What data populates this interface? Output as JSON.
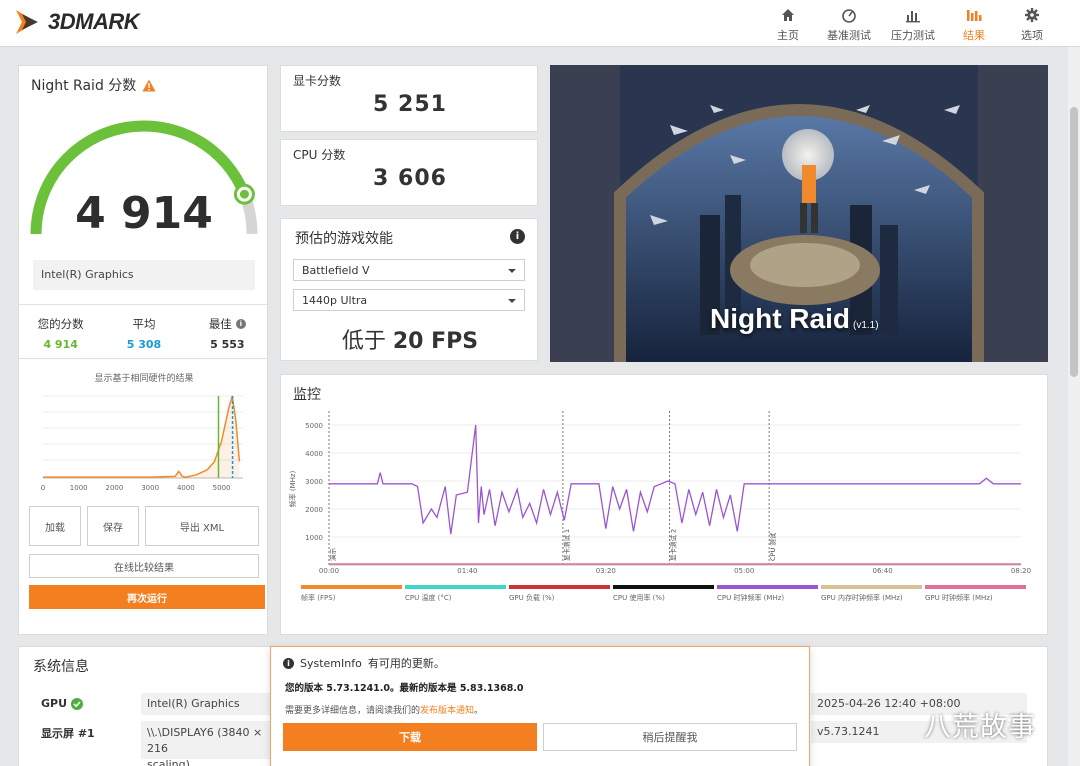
{
  "header": {
    "logo_text": "3DMARK",
    "nav": [
      {
        "label": "主页",
        "icon": "home-icon"
      },
      {
        "label": "基准测试",
        "icon": "gauge-icon"
      },
      {
        "label": "压力测试",
        "icon": "stress-icon"
      },
      {
        "label": "结果",
        "icon": "bar-chart-icon",
        "active": true
      },
      {
        "label": "选项",
        "icon": "gear-icon"
      }
    ],
    "accent_color": "#f47f20"
  },
  "score_card": {
    "title": "Night Raid 分数",
    "score": "4 914",
    "gauge_fraction": 0.88,
    "gpu": "Intel(R) Graphics",
    "stats": [
      {
        "label": "您的分数",
        "value": "4 914",
        "color": "#66b82f"
      },
      {
        "label": "平均",
        "value": "5 308",
        "color": "#1a9ad6"
      },
      {
        "label": "最佳",
        "value": "5 553",
        "color": "#333333"
      }
    ],
    "histogram_caption": "显示基于相同硬件的结果",
    "buttons": {
      "load": "加载",
      "save": "保存",
      "export": "导出 XML",
      "compare": "在线比较结果",
      "rerun": "再次运行"
    }
  },
  "gpu_score": {
    "label": "显卡分数",
    "value": "5 251"
  },
  "cpu_score": {
    "label": "CPU 分数",
    "value": "3 606"
  },
  "game_perf": {
    "title": "预估的游戏效能",
    "game": "Battlefield V",
    "resolution": "1440p Ultra",
    "fps_prefix": "低于",
    "fps_value": "20 FPS"
  },
  "hero": {
    "title": "Night Raid",
    "version": "(v1.1)"
  },
  "monitor": {
    "title": "监控",
    "y_label": "频率 (MHz)",
    "legend": [
      {
        "label": "帧率 (FPS)",
        "color": "#f08a2c"
      },
      {
        "label": "CPU 温度 (°C)",
        "color": "#3fd8c8"
      },
      {
        "label": "GPU 负载 (%)",
        "color": "#cc3333"
      },
      {
        "label": "CPU 使用率 (%)",
        "color": "#111111"
      },
      {
        "label": "CPU 时钟频率 (MHz)",
        "color": "#9b55d0"
      },
      {
        "label": "GPU 内存时钟频率 (MHz)",
        "color": "#d8c09a"
      },
      {
        "label": "GPU 时钟频率 (MHz)",
        "color": "#e0709a"
      }
    ]
  },
  "chart_data": [
    {
      "type": "line",
      "title": "",
      "xlabel": "",
      "ylabel": "频率 (MHz)",
      "x_ticks": [
        "00:00",
        "01:40",
        "03:20",
        "05:00",
        "06:40",
        "08:20"
      ],
      "y_ticks": [
        1000,
        2000,
        3000,
        4000,
        5000
      ],
      "ylim": [
        0,
        5500
      ],
      "markers": [
        "演示",
        "显卡测试 1",
        "显卡测试 2",
        "CPU 测试"
      ],
      "series": [
        {
          "name": "CPU 时钟频率 (MHz)",
          "x_seconds": [
            0,
            35,
            37,
            39,
            50,
            52,
            54,
            60,
            64,
            68,
            74,
            78,
            84,
            88,
            92,
            100,
            106,
            108,
            110,
            112,
            116,
            120,
            125,
            130,
            136,
            140,
            145,
            150,
            155,
            160,
            165,
            170,
            175,
            180,
            185,
            190,
            195,
            200,
            205,
            210,
            215,
            220,
            225,
            230,
            235,
            240,
            245,
            250,
            255,
            260,
            265,
            270,
            275,
            280,
            285,
            290,
            295,
            300,
            305,
            310,
            315,
            320,
            325,
            330,
            340,
            360,
            380,
            400,
            420,
            440,
            460,
            470,
            475,
            480,
            500
          ],
          "values": [
            2900,
            2900,
            3300,
            2900,
            2900,
            2900,
            2900,
            2900,
            2800,
            1500,
            2000,
            1700,
            2800,
            1100,
            2500,
            2600,
            5000,
            1500,
            2800,
            1800,
            2700,
            1400,
            2600,
            1900,
            2700,
            1700,
            2200,
            1500,
            2700,
            1800,
            2600,
            1600,
            2900,
            2900,
            2900,
            2900,
            2900,
            1300,
            2800,
            2000,
            2700,
            1200,
            2600,
            1900,
            2800,
            2900,
            3000,
            2900,
            1500,
            2700,
            1800,
            2600,
            1400,
            2700,
            1700,
            2500,
            1200,
            2900,
            2900,
            2900,
            2900,
            2900,
            2900,
            2900,
            2900,
            2900,
            2900,
            2900,
            2900,
            2900,
            2900,
            2900,
            3100,
            2900,
            2900
          ]
        },
        {
          "name": "GPU 时钟频率 (MHz)",
          "x_seconds": [
            0,
            500
          ],
          "values": [
            0,
            0
          ]
        }
      ]
    },
    {
      "type": "area",
      "title": "显示基于相同硬件的结果",
      "xlabel": "",
      "ylabel": "",
      "x_ticks": [
        0,
        1000,
        2000,
        3000,
        4000,
        5000
      ],
      "xlim": [
        0,
        5600
      ],
      "series": [
        {
          "name": "",
          "x": [
            0,
            1000,
            2000,
            3000,
            3700,
            3800,
            3900,
            4000,
            4300,
            4600,
            4800,
            5000,
            5200,
            5300,
            5400,
            5500
          ],
          "values": [
            0.01,
            0.01,
            0.01,
            0.01,
            0.02,
            0.08,
            0.02,
            0.01,
            0.04,
            0.1,
            0.2,
            0.45,
            0.85,
            1.0,
            0.7,
            0.2
          ]
        }
      ],
      "your_score": 4914,
      "average": 5308
    }
  ],
  "sysinfo": {
    "title": "系统信息",
    "rows": [
      {
        "label": "GPU",
        "value": "Intel(R) Graphics",
        "right_value": "2025-04-26 12:40 +08:00"
      },
      {
        "label": "显示屏 #1",
        "value": "\\\\.\\DISPLAY6 (3840 × 216",
        "value2": "scaling)",
        "right_value": "v5.73.1241"
      }
    ]
  },
  "popup": {
    "title_prefix": "SystemInfo",
    "title_suffix": "有可用的更新。",
    "line1": "您的版本 5.73.1241.0。最新的版本是 5.83.1368.0",
    "line2_prefix": "需要更多详细信息，请阅读我们的",
    "line2_link": "发布版本通知",
    "line2_suffix": "。",
    "download": "下载",
    "later": "稍后提醒我"
  },
  "watermark": "八荒故事"
}
